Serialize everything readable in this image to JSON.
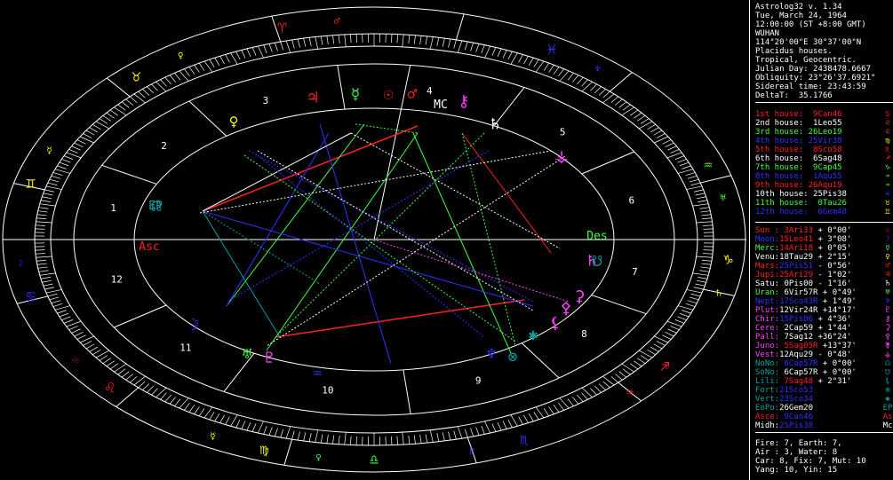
{
  "header": {
    "lines": [
      "Astrolog32 v. 1.34",
      "Tue, March 24, 1964",
      "12:00:00 (ST +8:00 GMT)",
      "WUHAN",
      "114°20'00\"E 30°37'00\"N",
      "Placidus houses.",
      "Tropical, Geocentric.",
      "Julian Day: 2438478.6667",
      "Obliquity: 23°26'37.6921\"",
      "Sidereal time: 23:43:59",
      "DeltaT:  35.1766"
    ]
  },
  "houses": [
    {
      "label": "1st house:",
      "value": " 9Can46",
      "color": "#ff2020",
      "glyph": "♋",
      "gcolor": "#ff2020"
    },
    {
      "label": "2nd house:",
      "value": " 1Leo55",
      "color": "#ffffff",
      "glyph": "♌",
      "gcolor": "#ff4040"
    },
    {
      "label": "3rd house:",
      "value": "26Leo19",
      "color": "#40ff40",
      "glyph": "♌",
      "gcolor": "#ff4040"
    },
    {
      "label": "4th house:",
      "value": "25Vir38",
      "color": "#3030ff",
      "glyph": "♍",
      "gcolor": "#ffff00"
    },
    {
      "label": "5th house:",
      "value": " 8Sco58",
      "color": "#ff2020",
      "glyph": "♏",
      "gcolor": "#ff2020"
    },
    {
      "label": "6th house:",
      "value": " 6Sag48",
      "color": "#ffffff",
      "glyph": "♐",
      "gcolor": "#ff2020"
    },
    {
      "label": "7th house:",
      "value": " 9Cap45",
      "color": "#40ff40",
      "glyph": "♑",
      "gcolor": "#40ff40"
    },
    {
      "label": "8th house:",
      "value": " 1Aqu55",
      "color": "#3030ff",
      "glyph": "♒",
      "gcolor": "#40ff40"
    },
    {
      "label": "9th house:",
      "value": "26Aqu19",
      "color": "#ff2020",
      "glyph": "♒",
      "gcolor": "#40ff40"
    },
    {
      "label": "10th house:",
      "value": "25Pis38",
      "color": "#ffffff",
      "glyph": "♓",
      "gcolor": "#3030ff"
    },
    {
      "label": "11th house:",
      "value": " 0Tau26",
      "color": "#40ff40",
      "glyph": "♉",
      "gcolor": "#ffff00"
    },
    {
      "label": "12th house:",
      "value": " 6Gem48",
      "color": "#3030ff",
      "glyph": "♊",
      "gcolor": "#ffff00"
    }
  ],
  "planets": [
    {
      "name": "Sun :",
      "pos": " 3Ari33",
      "lat": " + 0°00'",
      "color": "#ff2020",
      "vcolor": "#ff2020",
      "lcolor": "#ffffff",
      "glyph": "☉",
      "gcolor": "#ff2020"
    },
    {
      "name": "Moon:",
      "pos": "15Leo41",
      "lat": " + 3°08'",
      "color": "#3030ff",
      "vcolor": "#ff2020",
      "lcolor": "#ffffff",
      "glyph": "☽",
      "gcolor": "#3030ff"
    },
    {
      "name": "Merc:",
      "pos": "14Ari18",
      "lat": " + 0°05'",
      "color": "#40ff40",
      "vcolor": "#ff2020",
      "lcolor": "#ffffff",
      "glyph": "☿",
      "gcolor": "#40ff40"
    },
    {
      "name": "Venu:",
      "pos": "18Tau29",
      "lat": " + 2°15'",
      "color": "#ffffff",
      "vcolor": "#ffffff",
      "lcolor": "#ffffff",
      "glyph": "♀",
      "gcolor": "#ffff00"
    },
    {
      "name": "Mars:",
      "pos": "25Pis51",
      "lat": " - 0°56'",
      "color": "#ff2020",
      "vcolor": "#3030ff",
      "lcolor": "#ffffff",
      "glyph": "♂",
      "gcolor": "#ff2020"
    },
    {
      "name": "Jupi:",
      "pos": "25Ari29",
      "lat": " - 1°02'",
      "color": "#ff2020",
      "vcolor": "#ff2020",
      "lcolor": "#ffffff",
      "glyph": "♃",
      "gcolor": "#ff2020"
    },
    {
      "name": "Satu:",
      "pos": " 0Pis00",
      "lat": " - 1°16'",
      "color": "#ffffff",
      "vcolor": "#ffffff",
      "lcolor": "#ffffff",
      "glyph": "♄",
      "gcolor": "#ffffff"
    },
    {
      "name": "Uran:",
      "pos": " 6Vir57R",
      "lat": " + 0°49'",
      "color": "#40ff40",
      "vcolor": "#ffffff",
      "lcolor": "#ffffff",
      "glyph": "♅",
      "gcolor": "#40ff40"
    },
    {
      "name": "Nept:",
      "pos": "17Sco43R",
      "lat": " + 1°49'",
      "color": "#3030ff",
      "vcolor": "#3030ff",
      "lcolor": "#ffffff",
      "glyph": "♆",
      "gcolor": "#3030ff"
    },
    {
      "name": "Plut:",
      "pos": "12Vir24R",
      "lat": " +14°17'",
      "color": "#ff40ff",
      "vcolor": "#ffffff",
      "lcolor": "#ffffff",
      "glyph": "♇",
      "gcolor": "#ff40ff"
    },
    {
      "name": "Chir:",
      "pos": "15Pis06",
      "lat": " + 4°36'",
      "color": "#ff40ff",
      "vcolor": "#3030ff",
      "lcolor": "#ffffff",
      "glyph": "⚷",
      "gcolor": "#ff40ff"
    },
    {
      "name": "Cere:",
      "pos": " 2Cap59",
      "lat": " + 1°44'",
      "color": "#ff40ff",
      "vcolor": "#ffffff",
      "lcolor": "#ffffff",
      "glyph": "⚳",
      "gcolor": "#ff40ff"
    },
    {
      "name": "Pall:",
      "pos": " 7Sag12",
      "lat": " +36°24'",
      "color": "#ff40ff",
      "vcolor": "#ffffff",
      "lcolor": "#ffffff",
      "glyph": "⚴",
      "gcolor": "#ff40ff"
    },
    {
      "name": "Juno:",
      "pos": " 5Sag05R",
      "lat": " +13°37'",
      "color": "#ff40ff",
      "vcolor": "#ff2020",
      "lcolor": "#ffffff",
      "glyph": "⚵",
      "gcolor": "#ff40ff"
    },
    {
      "name": "Vest:",
      "pos": "12Aqu29",
      "lat": " - 0°48'",
      "color": "#ff40ff",
      "vcolor": "#ffffff",
      "lcolor": "#ffffff",
      "glyph": "⚶",
      "gcolor": "#ff40ff"
    },
    {
      "name": "NoNo:",
      "pos": " 6Cap57R",
      "lat": " + 0°00'",
      "color": "#00a0a0",
      "vcolor": "#3030ff",
      "lcolor": "#ffffff",
      "glyph": "☊",
      "gcolor": "#00a0a0"
    },
    {
      "name": "SoNo:",
      "pos": " 6Cap57R",
      "lat": " + 0°00'",
      "color": "#00a0a0",
      "vcolor": "#ffffff",
      "lcolor": "#ffffff",
      "glyph": "☋",
      "gcolor": "#00a0a0"
    },
    {
      "name": "Lili:",
      "pos": " 7Sag48",
      "lat": " + 2°31'",
      "color": "#00a0a0",
      "vcolor": "#ff2020",
      "lcolor": "#ffffff",
      "glyph": "⚸",
      "gcolor": "#00a0a0"
    },
    {
      "name": "Fort:",
      "pos": "21Sco53",
      "lat": "",
      "color": "#00a0a0",
      "vcolor": "#3030ff",
      "lcolor": "#ffffff",
      "glyph": "⊗",
      "gcolor": "#00a0a0"
    },
    {
      "name": "Vert:",
      "pos": "23Sco34",
      "lat": "",
      "color": "#00a0a0",
      "vcolor": "#3030ff",
      "lcolor": "#ffffff",
      "glyph": "✱",
      "gcolor": "#00a0a0"
    },
    {
      "name": "EoPo:",
      "pos": "26Gem20",
      "lat": "",
      "color": "#00a0a0",
      "vcolor": "#ffffff",
      "lcolor": "#ffffff",
      "glyph": "EP",
      "gcolor": "#00a0a0"
    },
    {
      "name": "Asce:",
      "pos": " 9Can46",
      "lat": "",
      "color": "#ff2020",
      "vcolor": "#3030ff",
      "lcolor": "#ffffff",
      "glyph": "As",
      "gcolor": "#ff2020"
    },
    {
      "name": "Midh:",
      "pos": "25Pis38",
      "lat": "",
      "color": "#ffffff",
      "vcolor": "#3030ff",
      "lcolor": "#ffffff",
      "glyph": "Mc",
      "gcolor": "#ffffff"
    }
  ],
  "summary": {
    "lines": [
      "Fire: 7, Earth: 7,",
      "Air : 3, Water: 8",
      "Car: 8, Fix: 7, Mut: 10",
      "Yang: 10, Yin: 15"
    ]
  },
  "chart": {
    "house_numbers": [
      "1",
      "2",
      "3",
      "4",
      "5",
      "6",
      "7",
      "8",
      "9",
      "10",
      "11",
      "12"
    ],
    "sign_glyphs": [
      {
        "g": "♈",
        "c": "#ff2020"
      },
      {
        "g": "♉",
        "c": "#ffff00"
      },
      {
        "g": "♊",
        "c": "#ffff00"
      },
      {
        "g": "♋",
        "c": "#3030ff"
      },
      {
        "g": "♌",
        "c": "#ff2020"
      },
      {
        "g": "♍",
        "c": "#ffff00"
      },
      {
        "g": "♎",
        "c": "#40ff40"
      },
      {
        "g": "♏",
        "c": "#3030ff"
      },
      {
        "g": "♐",
        "c": "#ff2020"
      },
      {
        "g": "♑",
        "c": "#ffff00"
      },
      {
        "g": "♒",
        "c": "#40ff40"
      },
      {
        "g": "♓",
        "c": "#3030ff"
      }
    ],
    "ruler_glyphs": [
      {
        "g": "♂",
        "c": "#ff2020"
      },
      {
        "g": "♀",
        "c": "#ffff00"
      },
      {
        "g": "☿",
        "c": "#ffff00"
      },
      {
        "g": "☽",
        "c": "#3030ff"
      },
      {
        "g": "☉",
        "c": "#ff2020"
      },
      {
        "g": "☿",
        "c": "#ffff00"
      },
      {
        "g": "♀",
        "c": "#40ff40"
      },
      {
        "g": "♇",
        "c": "#3030ff"
      },
      {
        "g": "♃",
        "c": "#ff2020"
      },
      {
        "g": "♄",
        "c": "#ffff00"
      },
      {
        "g": "♅",
        "c": "#40ff40"
      },
      {
        "g": "♆",
        "c": "#3030ff"
      }
    ],
    "axis_labels": {
      "asc": "Asc",
      "des": "Des",
      "mc": "MC",
      "ep": "EP"
    }
  }
}
